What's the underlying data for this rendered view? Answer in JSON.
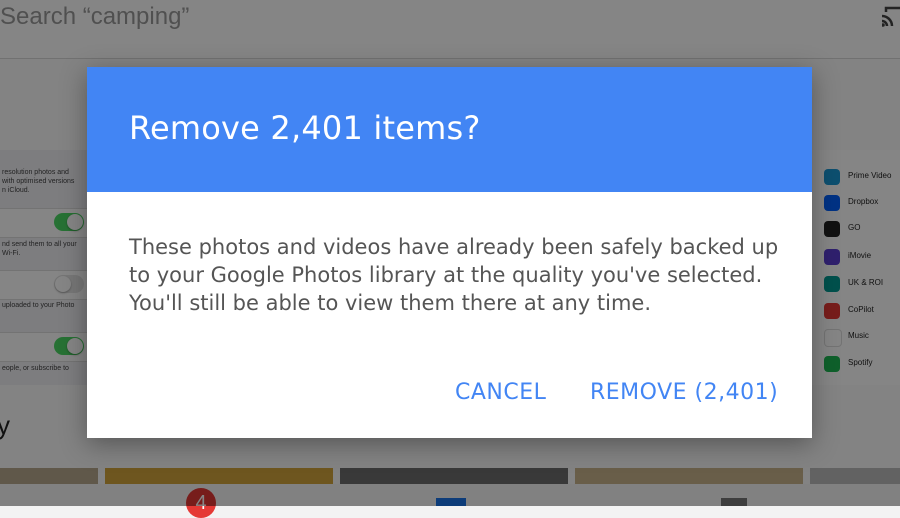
{
  "search": {
    "text": "Search “camping”"
  },
  "settings": {
    "lines": [
      "resolution photos and",
      "with optimised versions",
      "n iCloud.",
      "nd send them to all your",
      "Wi-Fi.",
      "uploaded to your Photo",
      "eople, or subscribe to"
    ]
  },
  "section_letter": "y",
  "apps": [
    {
      "label": "Prime Video",
      "color": "#1a98d5"
    },
    {
      "label": "Dropbox",
      "color": "#0061fe"
    },
    {
      "label": "GO",
      "color": "#222222"
    },
    {
      "label": "iMovie",
      "color": "#5b3fd1"
    },
    {
      "label": "UK & ROI",
      "color": "#009a93"
    },
    {
      "label": "CoPilot",
      "color": "#e53935"
    },
    {
      "label": "Music",
      "color": "#fc3c44"
    },
    {
      "label": "Spotify",
      "color": "#1db954"
    }
  ],
  "bottom_nav": {
    "badge_count": "4"
  },
  "dialog": {
    "title": "Remove 2,401 items?",
    "body": "These photos and videos have already been safely backed up to your Google Photos library at the quality you've selected. You'll still be able to view them there at any time.",
    "cancel_label": "CANCEL",
    "remove_label": "REMOVE (2,401)",
    "header_color": "#4285f4",
    "accent_color": "#4285f4"
  }
}
